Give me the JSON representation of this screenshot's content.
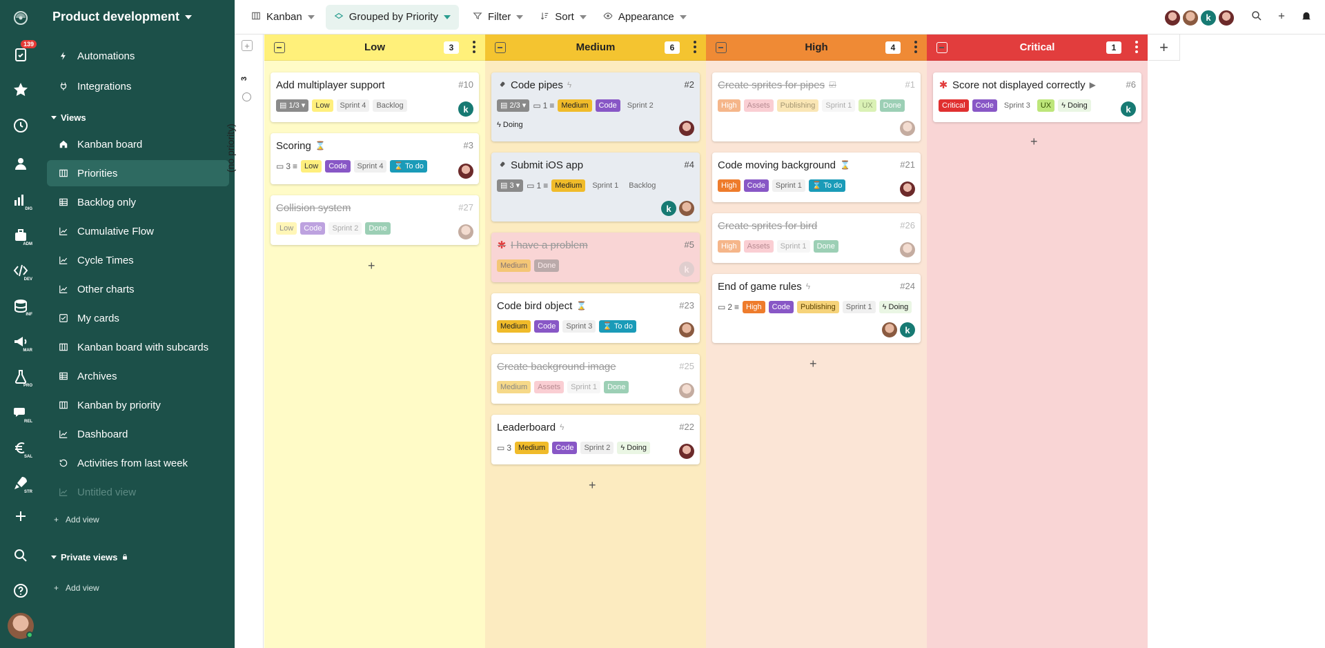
{
  "rail": {
    "tasks_badge": "139",
    "tags": [
      "DIG",
      "ADM",
      "DEV",
      "INF",
      "MAR",
      "PRO",
      "REL",
      "SAL",
      "STR"
    ]
  },
  "sidebar": {
    "title": "Product development",
    "top_items": [
      "Automations",
      "Integrations"
    ],
    "views_label": "Views",
    "views": [
      "Kanban board",
      "Priorities",
      "Backlog only",
      "Cumulative Flow",
      "Cycle Times",
      "Other charts",
      "My cards",
      "Kanban board with subcards",
      "Archives",
      "Kanban by priority",
      "Dashboard",
      "Activities from last week",
      "Untitled view"
    ],
    "add_view": "Add view",
    "private_label": "Private views",
    "add_view_private": "Add view"
  },
  "toolbar": {
    "kanban": "Kanban",
    "grouped": "Grouped by Priority",
    "filter": "Filter",
    "sort": "Sort",
    "appearance": "Appearance"
  },
  "board": {
    "no_priority": "(no priority)",
    "no_priority_count": "3",
    "columns": [
      {
        "name": "Low",
        "count": "3",
        "color": "#fff07a",
        "bg": "#fffbc7"
      },
      {
        "name": "Medium",
        "count": "6",
        "color": "#f4c430",
        "bg": "#fcebc0"
      },
      {
        "name": "High",
        "count": "4",
        "color": "#ef8a35",
        "bg": "#fbe5d6"
      },
      {
        "name": "Critical",
        "count": "1",
        "color": "#e23d3d",
        "bg": "#f9d5d5"
      }
    ],
    "cards": {
      "low": [
        {
          "title": "Add multiplayer support",
          "num": "#10",
          "sub": "1/3",
          "p": "Low",
          "sprint": "Sprint 4",
          "status": "Backlog"
        },
        {
          "title": "Scoring",
          "num": "#3",
          "comments": "3",
          "p": "Low",
          "tag": "Code",
          "sprint": "Sprint 4",
          "status": "To do"
        },
        {
          "title": "Collision system",
          "num": "#27",
          "p": "Low",
          "tag": "Code",
          "sprint": "Sprint 2",
          "status": "Done"
        }
      ],
      "medium": [
        {
          "title": "Code pipes",
          "num": "#2",
          "sub": "2/3",
          "comments": "1",
          "p": "Medium",
          "tag": "Code",
          "sprint": "Sprint 2",
          "status": "Doing"
        },
        {
          "title": "Submit iOS app",
          "num": "#4",
          "sub": "3",
          "comments": "1",
          "p": "Medium",
          "sprint": "Sprint 1",
          "status": "Backlog"
        },
        {
          "title": "I have a problem",
          "num": "#5",
          "p": "Medium",
          "status": "Done"
        },
        {
          "title": "Code bird object",
          "num": "#23",
          "p": "Medium",
          "tag": "Code",
          "sprint": "Sprint 3",
          "status": "To do"
        },
        {
          "title": "Create background image",
          "num": "#25",
          "p": "Medium",
          "tag": "Assets",
          "sprint": "Sprint 1",
          "status": "Done"
        },
        {
          "title": "Leaderboard",
          "num": "#22",
          "comments": "3",
          "p": "Medium",
          "tag": "Code",
          "sprint": "Sprint 2",
          "status": "Doing"
        }
      ],
      "high": [
        {
          "title": "Create sprites for pipes",
          "num": "#1",
          "p": "High",
          "tag": "Assets",
          "tag2": "Publishing",
          "sprint": "Sprint 1",
          "tag3": "UX",
          "status": "Done"
        },
        {
          "title": "Code moving background",
          "num": "#21",
          "p": "High",
          "tag": "Code",
          "sprint": "Sprint 1",
          "status": "To do"
        },
        {
          "title": "Create sprites for bird",
          "num": "#26",
          "p": "High",
          "tag": "Assets",
          "sprint": "Sprint 1",
          "status": "Done"
        },
        {
          "title": "End of game rules",
          "num": "#24",
          "comments": "2",
          "p": "High",
          "tag": "Code",
          "tag2": "Publishing",
          "sprint": "Sprint 1",
          "status": "Doing"
        }
      ],
      "critical": [
        {
          "title": "Score not displayed correctly",
          "num": "#6",
          "p": "Critical",
          "tag": "Code",
          "sprint": "Sprint 3",
          "tag3": "UX",
          "status": "Doing"
        }
      ]
    }
  },
  "add_symbol": "+",
  "avatar_letter": "k"
}
